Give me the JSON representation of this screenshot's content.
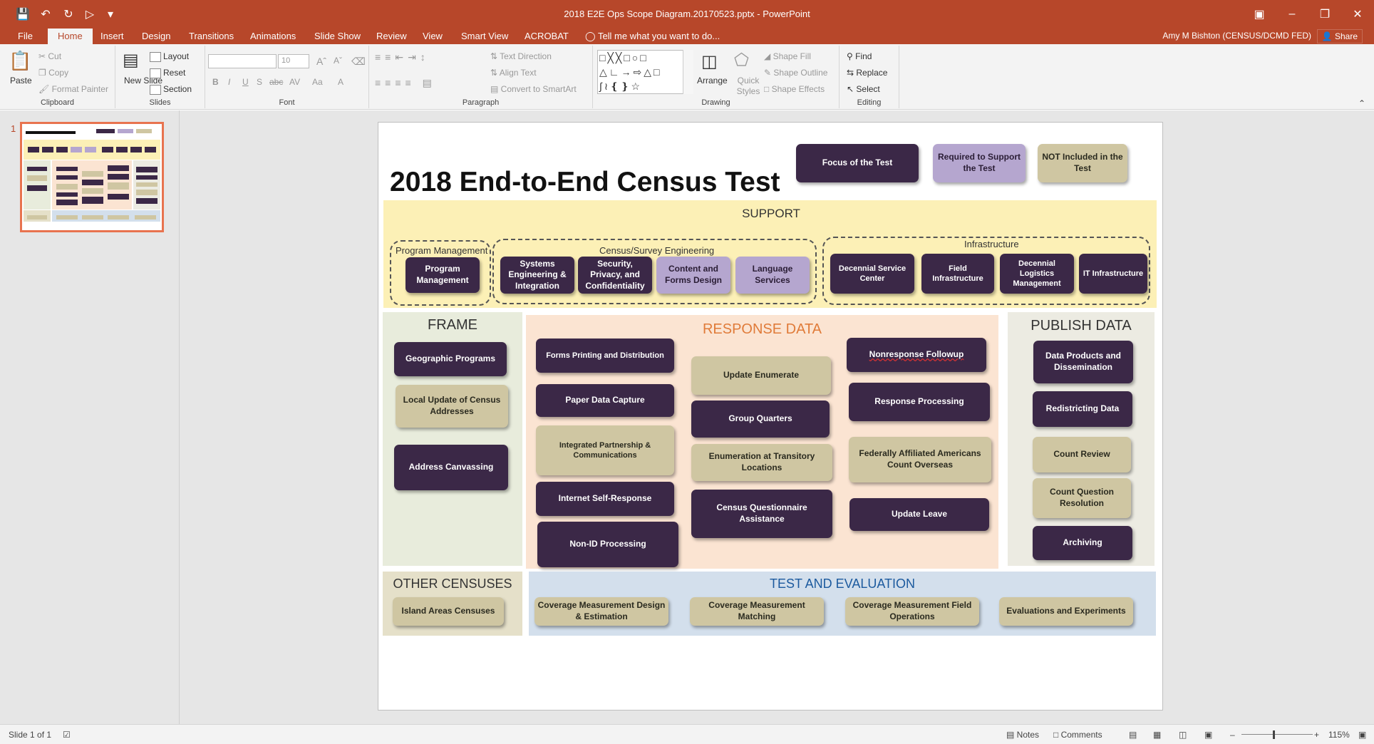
{
  "window": {
    "title": "2018 E2E Ops Scope Diagram.20170523.pptx - PowerPoint",
    "account": "Amy M Bishton (CENSUS/DCMD FED)",
    "share_label": "Share"
  },
  "tabs": [
    "File",
    "Home",
    "Insert",
    "Design",
    "Transitions",
    "Animations",
    "Slide Show",
    "Review",
    "View",
    "Smart View",
    "ACROBAT"
  ],
  "tell_me": "Tell me what you want to do...",
  "ribbon": {
    "clipboard": {
      "label": "Clipboard",
      "paste": "Paste",
      "cut": "Cut",
      "copy": "Copy",
      "format_painter": "Format Painter"
    },
    "slides": {
      "label": "Slides",
      "new_slide": "New Slide",
      "layout": "Layout",
      "reset": "Reset",
      "section": "Section"
    },
    "font": {
      "label": "Font",
      "size": "10"
    },
    "paragraph": {
      "label": "Paragraph",
      "text_direction": "Text Direction",
      "align_text": "Align Text",
      "convert": "Convert to SmartArt"
    },
    "drawing": {
      "label": "Drawing",
      "arrange": "Arrange",
      "quick_styles": "Quick Styles",
      "shape_fill": "Shape Fill",
      "shape_outline": "Shape Outline",
      "shape_effects": "Shape Effects"
    },
    "editing": {
      "label": "Editing",
      "find": "Find",
      "replace": "Replace",
      "select": "Select"
    }
  },
  "thumbnail": {
    "number": "1"
  },
  "slide": {
    "title": "2018 End-to-End Census Test",
    "legend": {
      "focus": "Focus of the Test",
      "required": "Required to Support the Test",
      "not_included": "NOT Included in the Test"
    },
    "support": {
      "label": "SUPPORT",
      "program_management": {
        "label": "Program Management",
        "items": [
          "Program Management"
        ]
      },
      "engineering": {
        "label": "Census/Survey Engineering",
        "items": [
          "Systems Engineering & Integration",
          "Security, Privacy, and Confidentiality",
          "Content and Forms Design",
          "Language Services"
        ]
      },
      "infrastructure": {
        "label": "Infrastructure",
        "items": [
          "Decennial Service Center",
          "Field Infrastructure",
          "Decennial Logistics Management",
          "IT Infrastructure"
        ]
      }
    },
    "frame": {
      "label": "FRAME",
      "items": [
        "Geographic Programs",
        "Local Update of Census Addresses",
        "Address Canvassing"
      ]
    },
    "response": {
      "label": "RESPONSE DATA",
      "col1": [
        "Forms Printing and Distribution",
        "Paper Data Capture",
        "Integrated Partnership & Communications",
        "Internet Self-Response",
        "Non-ID Processing"
      ],
      "col2": [
        "Update Enumerate",
        "Group Quarters",
        "Enumeration at Transitory Locations",
        "Census Questionnaire Assistance"
      ],
      "col3": [
        "Nonresponse Followup",
        "Response Processing",
        "Federally Affiliated Americans Count Overseas",
        "Update Leave"
      ]
    },
    "publish": {
      "label": "PUBLISH DATA",
      "items": [
        "Data Products and Dissemination",
        "Redistricting Data",
        "Count Review",
        "Count Question Resolution",
        "Archiving"
      ]
    },
    "other": {
      "label": "OTHER CENSUSES",
      "items": [
        "Island Areas Censuses"
      ]
    },
    "test_eval": {
      "label": "TEST AND EVALUATION",
      "items": [
        "Coverage Measurement Design & Estimation",
        "Coverage Measurement Matching",
        "Coverage Measurement Field Operations",
        "Evaluations and Experiments"
      ]
    }
  },
  "status": {
    "slide_of": "Slide 1 of 1",
    "notes": "Notes",
    "comments": "Comments",
    "zoom": "115%"
  },
  "colors": {
    "accent": "#b7472a",
    "focus": "#3b2847",
    "required": "#b5a6cf",
    "not_included": "#cfc6a2"
  }
}
